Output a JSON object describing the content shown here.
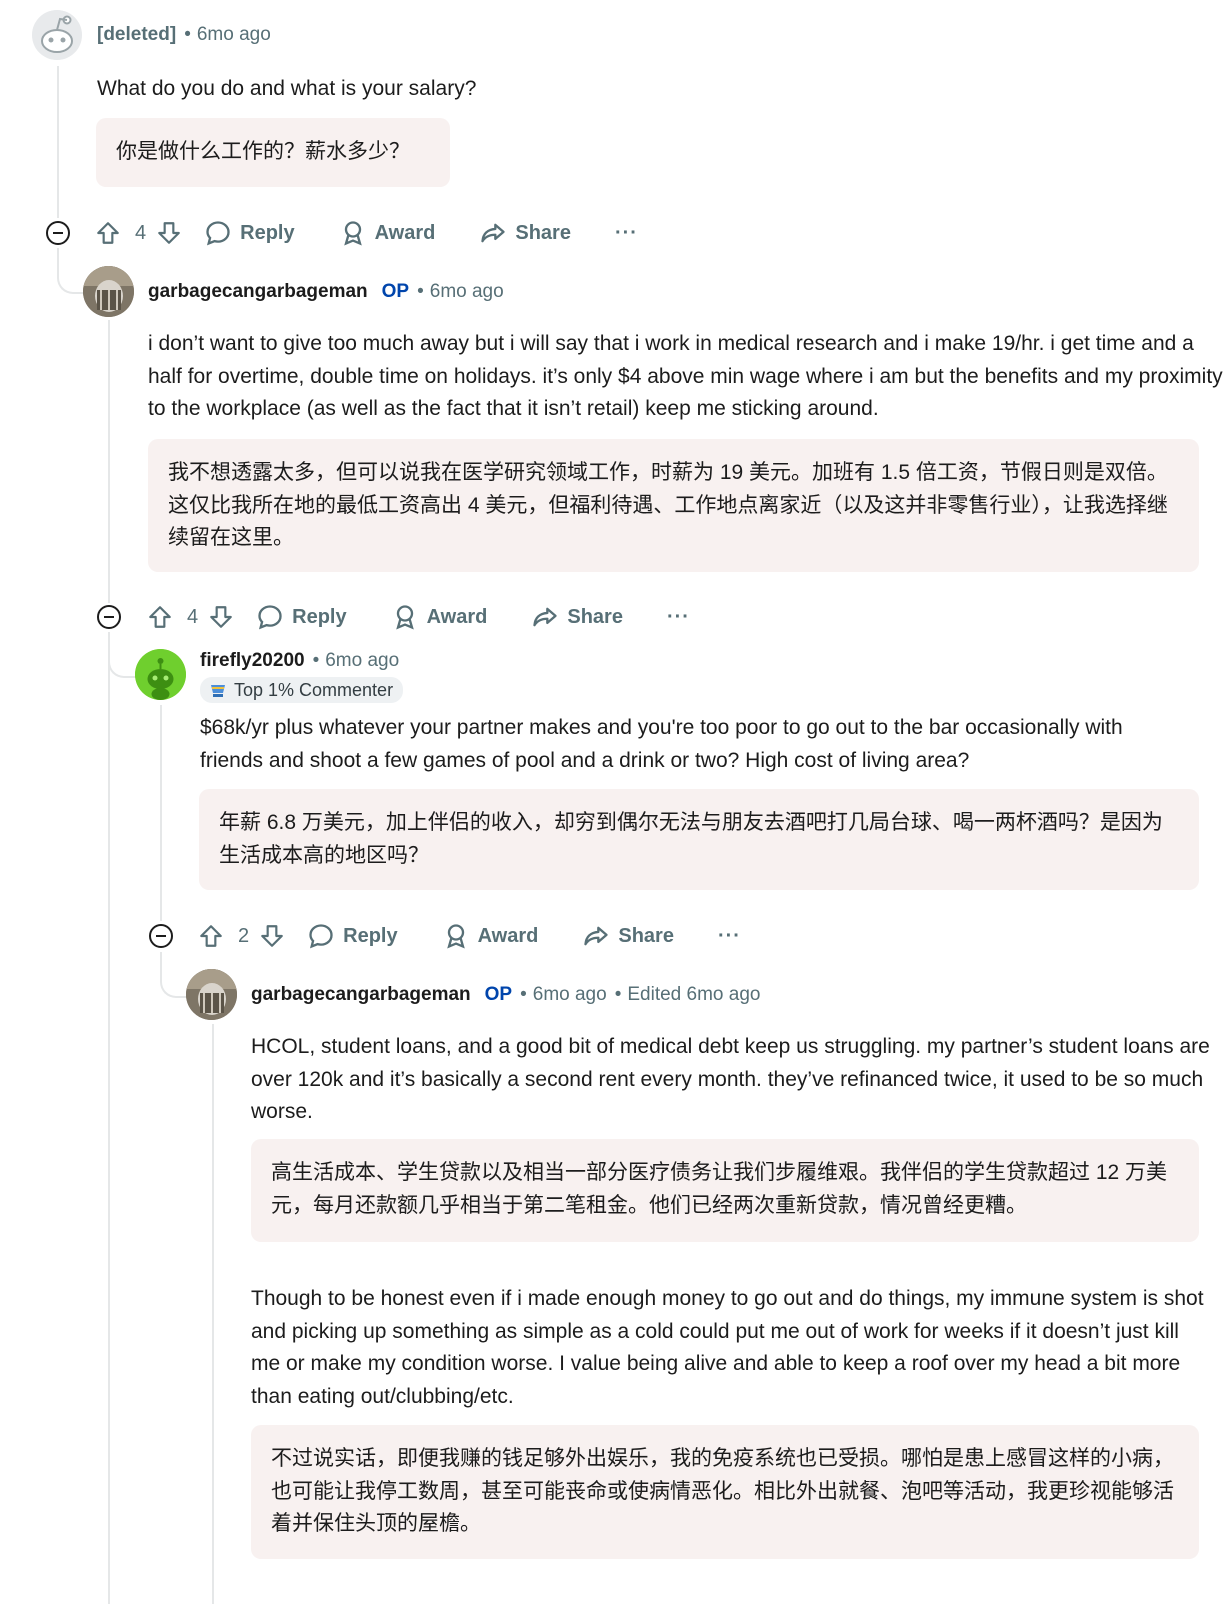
{
  "comments": [
    {
      "author": "[deleted]",
      "time": "6mo ago",
      "body": "What do you do and what is your salary?",
      "translation": "你是做什么工作的？薪水多少？",
      "votes": "4"
    },
    {
      "author": "garbagecangarbageman",
      "op": "OP",
      "time": "6mo ago",
      "body": "i don’t want to give too much away but i will say that i work in medical research and i make 19/hr. i get time and a half for overtime, double time on holidays. it’s only $4 above min wage where i am but the benefits and my proximity to the workplace (as well as the fact that it isn’t retail) keep me sticking around.",
      "translation": "我不想透露太多，但可以说我在医学研究领域工作，时薪为 19 美元。加班有 1.5 倍工资，节假日则是双倍。这仅比我所在地的最低工资高出 4 美元，但福利待遇、工作地点离家近（以及这并非零售行业），让我选择继续留在这里。",
      "votes": "4"
    },
    {
      "author": "firefly20200",
      "time": "6mo ago",
      "badge": "Top 1% Commenter",
      "body": "$68k/yr plus whatever your partner makes and you're too poor to go out to the bar occasionally with friends and shoot a few games of pool and a drink or two? High cost of living area?",
      "translation": "年薪 6.8 万美元，加上伴侣的收入，却穷到偶尔无法与朋友去酒吧打几局台球、喝一两杯酒吗？是因为生活成本高的地区吗？",
      "votes": "2"
    },
    {
      "author": "garbagecangarbageman",
      "op": "OP",
      "time": "6mo ago",
      "edited": "Edited 6mo ago",
      "body": "HCOL, student loans, and a good bit of medical debt keep us struggling. my partner’s student loans are over 120k and it’s basically a second rent every month. they’ve refinanced twice, it used to be so much worse.",
      "translation": "高生活成本、学生贷款以及相当一部分医疗债务让我们步履维艰。我伴侣的学生贷款超过 12 万美元，每月还款额几乎相当于第二笔租金。他们已经两次重新贷款，情况曾经更糟。",
      "body2": "Though to be honest even if i made enough money to go out and do things, my immune system is shot and picking up something as simple as a cold could put me out of work for weeks if it doesn’t just kill me or make my condition worse. I value being alive and able to keep a roof over my head a bit more than eating out/clubbing/etc.",
      "translation2": "不过说实话，即便我赚的钱足够外出娱乐，我的免疫系统也已受损。哪怕是患上感冒这样的小病，也可能让我停工数周，甚至可能丧命或使病情恶化。相比外出就餐、泡吧等活动，我更珍视能够活着并保住头顶的屋檐。"
    }
  ],
  "actions": {
    "reply": "Reply",
    "award": "Award",
    "share": "Share",
    "more": "···"
  },
  "colors": {
    "op": "#0045ac",
    "meta": "#576f76",
    "translation_bg": "#f8f1f0"
  }
}
